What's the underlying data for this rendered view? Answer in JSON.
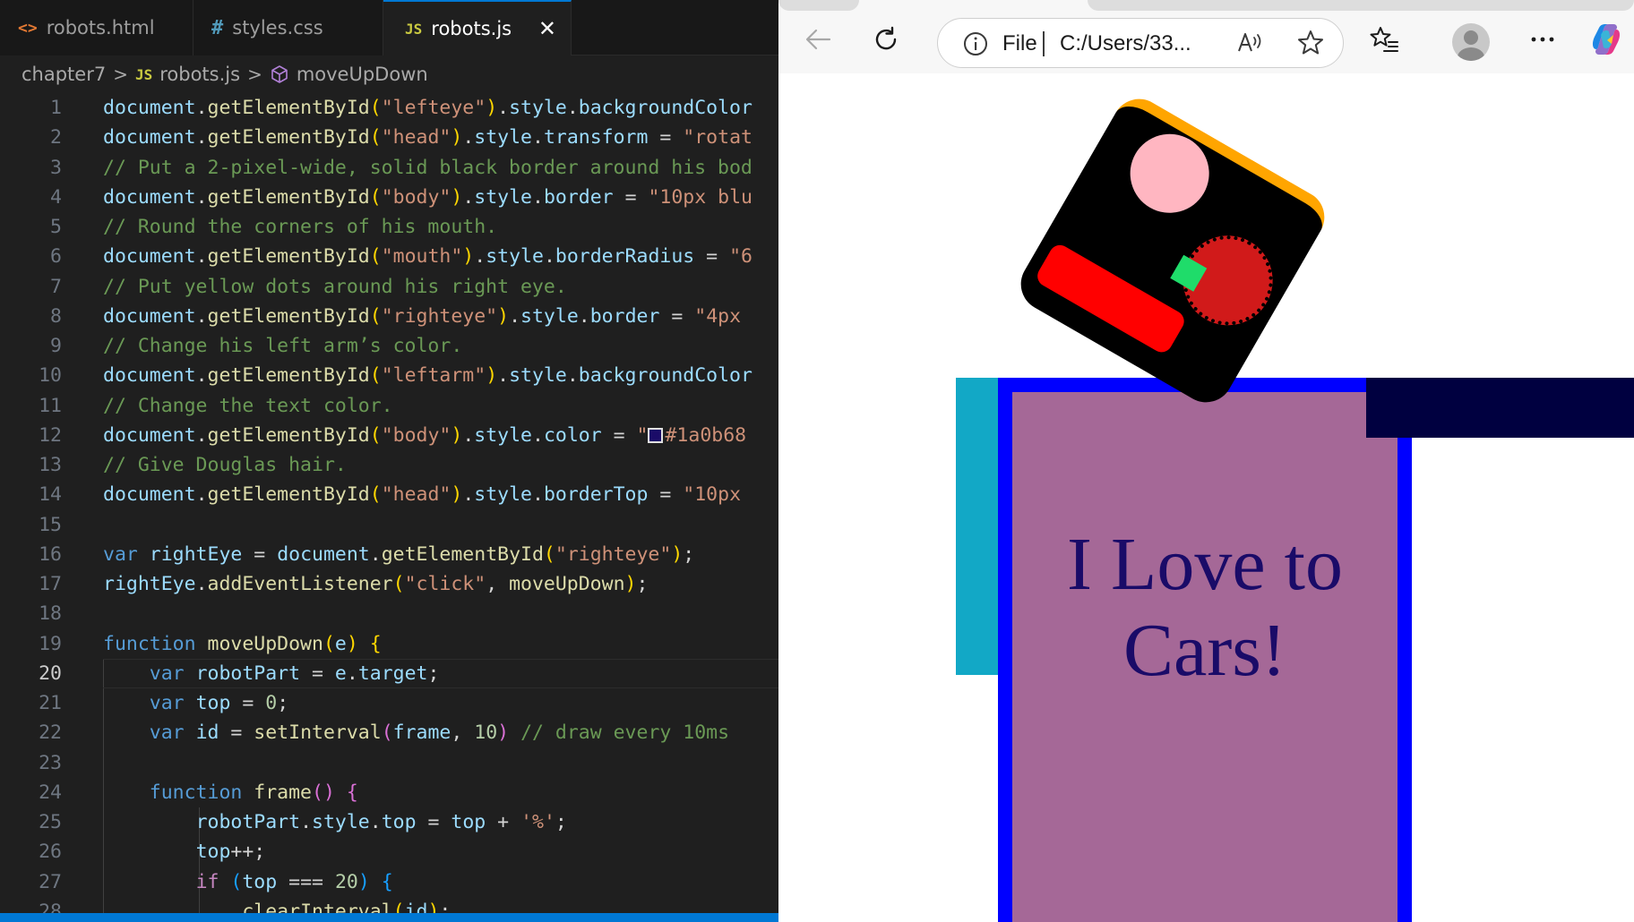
{
  "editor": {
    "tabs": [
      {
        "label": "robots.html",
        "icon": "html-file-icon",
        "icon_glyph": "<>"
      },
      {
        "label": "styles.css",
        "icon": "css-file-icon",
        "icon_glyph": "#"
      },
      {
        "label": "robots.js",
        "icon": "js-file-icon",
        "icon_glyph": "JS"
      }
    ],
    "close_glyph": "✕",
    "breadcrumb": {
      "folder": "chapter7",
      "separator": ">",
      "file_icon": "JS",
      "file": "robots.js",
      "symbol": "moveUpDown"
    },
    "current_line": 20,
    "lines": [
      {
        "num": "1",
        "tokens": [
          [
            "v",
            "document"
          ],
          [
            "d",
            "."
          ],
          [
            "f",
            "getElementById"
          ],
          [
            "b1",
            "("
          ],
          [
            "s",
            "\"lefteye\""
          ],
          [
            "b1",
            ")"
          ],
          [
            "d",
            "."
          ],
          [
            "v",
            "style"
          ],
          [
            "d",
            "."
          ],
          [
            "v",
            "backgroundColor"
          ]
        ]
      },
      {
        "num": "2",
        "tokens": [
          [
            "v",
            "document"
          ],
          [
            "d",
            "."
          ],
          [
            "f",
            "getElementById"
          ],
          [
            "b1",
            "("
          ],
          [
            "s",
            "\"head\""
          ],
          [
            "b1",
            ")"
          ],
          [
            "d",
            "."
          ],
          [
            "v",
            "style"
          ],
          [
            "d",
            "."
          ],
          [
            "v",
            "transform"
          ],
          [
            "d",
            " = "
          ],
          [
            "s",
            "\"rotat"
          ]
        ]
      },
      {
        "num": "3",
        "tokens": [
          [
            "c",
            "// Put a 2-pixel-wide, solid black border around his bod"
          ]
        ]
      },
      {
        "num": "4",
        "tokens": [
          [
            "v",
            "document"
          ],
          [
            "d",
            "."
          ],
          [
            "f",
            "getElementById"
          ],
          [
            "b1",
            "("
          ],
          [
            "s",
            "\"body\""
          ],
          [
            "b1",
            ")"
          ],
          [
            "d",
            "."
          ],
          [
            "v",
            "style"
          ],
          [
            "d",
            "."
          ],
          [
            "v",
            "border"
          ],
          [
            "d",
            " = "
          ],
          [
            "s",
            "\"10px blu"
          ]
        ]
      },
      {
        "num": "5",
        "tokens": [
          [
            "c",
            "// Round the corners of his mouth."
          ]
        ]
      },
      {
        "num": "6",
        "tokens": [
          [
            "v",
            "document"
          ],
          [
            "d",
            "."
          ],
          [
            "f",
            "getElementById"
          ],
          [
            "b1",
            "("
          ],
          [
            "s",
            "\"mouth\""
          ],
          [
            "b1",
            ")"
          ],
          [
            "d",
            "."
          ],
          [
            "v",
            "style"
          ],
          [
            "d",
            "."
          ],
          [
            "v",
            "borderRadius"
          ],
          [
            "d",
            " = "
          ],
          [
            "s",
            "\"6"
          ]
        ]
      },
      {
        "num": "7",
        "tokens": [
          [
            "c",
            "// Put yellow dots around his right eye."
          ]
        ]
      },
      {
        "num": "8",
        "tokens": [
          [
            "v",
            "document"
          ],
          [
            "d",
            "."
          ],
          [
            "f",
            "getElementById"
          ],
          [
            "b1",
            "("
          ],
          [
            "s",
            "\"righteye\""
          ],
          [
            "b1",
            ")"
          ],
          [
            "d",
            "."
          ],
          [
            "v",
            "style"
          ],
          [
            "d",
            "."
          ],
          [
            "v",
            "border"
          ],
          [
            "d",
            " = "
          ],
          [
            "s",
            "\"4px"
          ]
        ]
      },
      {
        "num": "9",
        "tokens": [
          [
            "c",
            "// Change his left arm’s color."
          ]
        ]
      },
      {
        "num": "10",
        "tokens": [
          [
            "v",
            "document"
          ],
          [
            "d",
            "."
          ],
          [
            "f",
            "getElementById"
          ],
          [
            "b1",
            "("
          ],
          [
            "s",
            "\"leftarm\""
          ],
          [
            "b1",
            ")"
          ],
          [
            "d",
            "."
          ],
          [
            "v",
            "style"
          ],
          [
            "d",
            "."
          ],
          [
            "v",
            "backgroundColor"
          ]
        ]
      },
      {
        "num": "11",
        "tokens": [
          [
            "c",
            "// Change the text color."
          ]
        ]
      },
      {
        "num": "12",
        "tokens": [
          [
            "v",
            "document"
          ],
          [
            "d",
            "."
          ],
          [
            "f",
            "getElementById"
          ],
          [
            "b1",
            "("
          ],
          [
            "s",
            "\"body\""
          ],
          [
            "b1",
            ")"
          ],
          [
            "d",
            "."
          ],
          [
            "v",
            "style"
          ],
          [
            "d",
            "."
          ],
          [
            "v",
            "color"
          ],
          [
            "d",
            " = "
          ],
          [
            "s",
            "\""
          ],
          [
            "swatch",
            ""
          ],
          [
            "s",
            "#1a0b68"
          ]
        ]
      },
      {
        "num": "13",
        "tokens": [
          [
            "c",
            "// Give Douglas hair."
          ]
        ]
      },
      {
        "num": "14",
        "tokens": [
          [
            "v",
            "document"
          ],
          [
            "d",
            "."
          ],
          [
            "f",
            "getElementById"
          ],
          [
            "b1",
            "("
          ],
          [
            "s",
            "\"head\""
          ],
          [
            "b1",
            ")"
          ],
          [
            "d",
            "."
          ],
          [
            "v",
            "style"
          ],
          [
            "d",
            "."
          ],
          [
            "v",
            "borderTop"
          ],
          [
            "d",
            " = "
          ],
          [
            "s",
            "\"10px"
          ]
        ]
      },
      {
        "num": "15",
        "tokens": []
      },
      {
        "num": "16",
        "tokens": [
          [
            "k",
            "var "
          ],
          [
            "v",
            "rightEye"
          ],
          [
            "d",
            " = "
          ],
          [
            "v",
            "document"
          ],
          [
            "d",
            "."
          ],
          [
            "f",
            "getElementById"
          ],
          [
            "b1",
            "("
          ],
          [
            "s",
            "\"righteye\""
          ],
          [
            "b1",
            ")"
          ],
          [
            "d",
            ";"
          ]
        ]
      },
      {
        "num": "17",
        "tokens": [
          [
            "v",
            "rightEye"
          ],
          [
            "d",
            "."
          ],
          [
            "f",
            "addEventListener"
          ],
          [
            "b1",
            "("
          ],
          [
            "s",
            "\"click\""
          ],
          [
            "d",
            ", "
          ],
          [
            "f",
            "moveUpDown"
          ],
          [
            "b1",
            ")"
          ],
          [
            "d",
            ";"
          ]
        ]
      },
      {
        "num": "18",
        "tokens": []
      },
      {
        "num": "19",
        "tokens": [
          [
            "k",
            "function "
          ],
          [
            "f",
            "moveUpDown"
          ],
          [
            "b1",
            "("
          ],
          [
            "v",
            "e"
          ],
          [
            "b1",
            ")"
          ],
          [
            "d",
            " "
          ],
          [
            "b1",
            "{"
          ]
        ]
      },
      {
        "num": "20",
        "tokens": [
          [
            "d",
            "    "
          ],
          [
            "k",
            "var "
          ],
          [
            "v",
            "robotPart"
          ],
          [
            "d",
            " = "
          ],
          [
            "v",
            "e"
          ],
          [
            "d",
            "."
          ],
          [
            "v",
            "target"
          ],
          [
            "d",
            ";"
          ]
        ]
      },
      {
        "num": "21",
        "tokens": [
          [
            "d",
            "    "
          ],
          [
            "k",
            "var "
          ],
          [
            "v",
            "top"
          ],
          [
            "d",
            " = "
          ],
          [
            "n",
            "0"
          ],
          [
            "d",
            ";"
          ]
        ]
      },
      {
        "num": "22",
        "tokens": [
          [
            "d",
            "    "
          ],
          [
            "k",
            "var "
          ],
          [
            "v",
            "id"
          ],
          [
            "d",
            " = "
          ],
          [
            "f",
            "setInterval"
          ],
          [
            "b2",
            "("
          ],
          [
            "v",
            "frame"
          ],
          [
            "d",
            ", "
          ],
          [
            "n",
            "10"
          ],
          [
            "b2",
            ")"
          ],
          [
            "d",
            " "
          ],
          [
            "c",
            "// draw every 10ms"
          ]
        ]
      },
      {
        "num": "23",
        "tokens": []
      },
      {
        "num": "24",
        "tokens": [
          [
            "d",
            "    "
          ],
          [
            "k",
            "function "
          ],
          [
            "f",
            "frame"
          ],
          [
            "b2",
            "()"
          ],
          [
            "d",
            " "
          ],
          [
            "b2",
            "{"
          ]
        ]
      },
      {
        "num": "25",
        "tokens": [
          [
            "d",
            "        "
          ],
          [
            "v",
            "robotPart"
          ],
          [
            "d",
            "."
          ],
          [
            "v",
            "style"
          ],
          [
            "d",
            "."
          ],
          [
            "v",
            "top"
          ],
          [
            "d",
            " = "
          ],
          [
            "v",
            "top"
          ],
          [
            "d",
            " + "
          ],
          [
            "s",
            "'%'"
          ],
          [
            "d",
            ";"
          ]
        ]
      },
      {
        "num": "26",
        "tokens": [
          [
            "d",
            "        "
          ],
          [
            "v",
            "top"
          ],
          [
            "d",
            "++;"
          ]
        ]
      },
      {
        "num": "27",
        "tokens": [
          [
            "d",
            "        "
          ],
          [
            "ctl",
            "if "
          ],
          [
            "b3",
            "("
          ],
          [
            "v",
            "top"
          ],
          [
            "d",
            " === "
          ],
          [
            "n",
            "20"
          ],
          [
            "b3",
            ")"
          ],
          [
            "d",
            " "
          ],
          [
            "b3",
            "{"
          ]
        ]
      },
      {
        "num": "28",
        "tokens": [
          [
            "d",
            "            "
          ],
          [
            "f",
            "clearInterval"
          ],
          [
            "b1",
            "("
          ],
          [
            "v",
            "id"
          ],
          [
            "b1",
            ")"
          ],
          [
            "d",
            ";"
          ]
        ]
      }
    ]
  },
  "browser": {
    "address_scheme": "File",
    "address_path": "C:/Users/33...",
    "icons": [
      "back-arrow-icon",
      "refresh-icon",
      "info-icon",
      "read-aloud-icon",
      "favorite-star-icon",
      "favorites-list-icon",
      "profile-avatar-icon",
      "more-menu-icon",
      "copilot-icon"
    ],
    "page": {
      "body_text": "I Love to Cars!"
    },
    "colors": {
      "head": "#000000",
      "hair": "#ffa500",
      "left_eye": "#ffb6c1",
      "right_eye": "#d11a1a",
      "nose": "#1fdc6a",
      "mouth": "#ff0000",
      "body_border": "#0000ff",
      "body_fill": "#a56897",
      "body_text": "#1a0b68",
      "left_arm": "#12a8c6",
      "right_arm": "#000040"
    }
  }
}
